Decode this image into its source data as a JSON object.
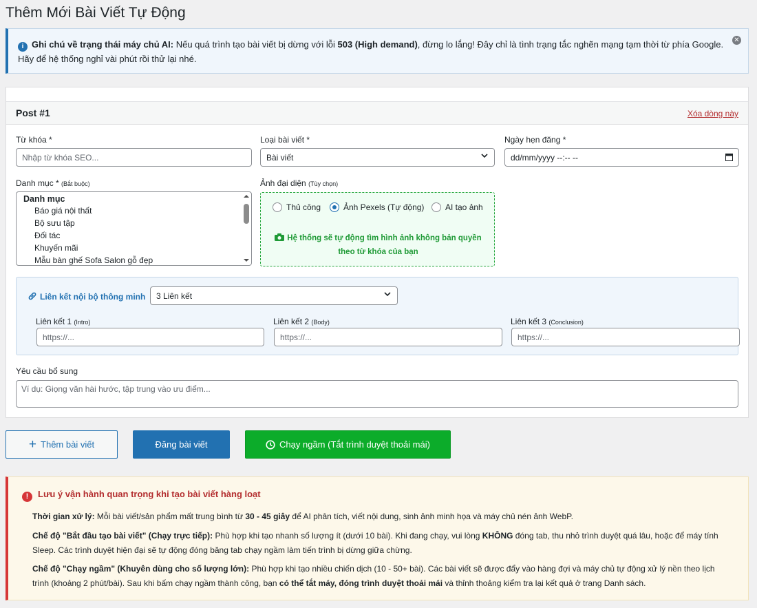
{
  "page": {
    "title": "Thêm Mới Bài Viết Tự Động"
  },
  "notice": {
    "label": "Ghi chú về trạng thái máy chủ AI:",
    "text_a": " Nếu quá trình tạo bài viết bị dừng với lỗi ",
    "error": "503 (High demand)",
    "text_b": ", đừng lo lắng! Đây chỉ là tình trạng tắc nghẽn mạng tạm thời từ phía Google. Hãy để hệ thống nghỉ vài phút rồi thử lại nhé.",
    "info_icon": "i",
    "close_icon": "✕"
  },
  "post": {
    "title": "Post #1",
    "delete_label": "Xóa dòng này",
    "keyword": {
      "label": "Từ khóa *",
      "placeholder": "Nhập từ khóa SEO...",
      "value": ""
    },
    "post_type": {
      "label": "Loại bài viết *",
      "value": "Bài viết"
    },
    "schedule": {
      "label": "Ngày hẹn đăng *",
      "value": "dd/mm/yyyy --:-- --"
    },
    "category": {
      "label": "Danh mục *",
      "note": "(Bắt buộc)",
      "header": "Danh mục",
      "items": [
        "Báo giá nội thất",
        "Bộ sưu tập",
        "Đối tác",
        "Khuyến mãi",
        "Mẫu bàn ghế Sofa Salon gỗ đẹp"
      ]
    },
    "image": {
      "label": "Ảnh đại diện",
      "note": "(Tùy chọn)",
      "options": [
        {
          "label": "Thủ công",
          "selected": false
        },
        {
          "label": "Ảnh Pexels (Tự động)",
          "selected": true
        },
        {
          "label": "AI tạo ảnh",
          "selected": false
        }
      ],
      "message_line1": "Hệ thống sẽ tự động tìm hình ảnh không bản quyền",
      "message_line2": "theo từ khóa của bạn",
      "camera_icon": "camera-icon"
    },
    "internal_links": {
      "label": "Liên kết nội bộ thông minh",
      "count_value": "3 Liên kết",
      "link1": {
        "label": "Liên kết 1",
        "note": "(Intro)",
        "placeholder": "https://..."
      },
      "link2": {
        "label": "Liên kết 2",
        "note": "(Body)",
        "placeholder": "https://..."
      },
      "link3": {
        "label": "Liên kết 3",
        "note": "(Conclusion)",
        "placeholder": "https://..."
      }
    },
    "extra": {
      "label": "Yêu cầu bổ sung",
      "placeholder": "Ví dụ: Giọng văn hài hước, tập trung vào ưu điểm..."
    }
  },
  "actions": {
    "add_label": "Thêm bài viết",
    "post_label": "Đăng bài viết",
    "background_label": "Chạy ngầm (Tắt trình duyệt thoải mái)"
  },
  "warning": {
    "title": "Lưu ý vận hành quan trọng khi tạo bài viết hàng loạt",
    "p1_label": "Thời gian xử lý:",
    "p1_a": " Mỗi bài viết/sản phẩm mất trung bình từ ",
    "p1_b": "30 - 45 giây",
    "p1_c": " để AI phân tích, viết nội dung, sinh ảnh minh họa và máy chủ nén ảnh WebP.",
    "p2_label": "Chế độ \"Bắt đầu tạo bài viết\" (Chạy trực tiếp):",
    "p2_a": " Phù hợp khi tạo nhanh số lượng ít (dưới 10 bài). Khi đang chạy, vui lòng ",
    "p2_b": "KHÔNG",
    "p2_c": " đóng tab, thu nhỏ trình duyệt quá lâu, hoặc để máy tính Sleep. Các trình duyệt hiện đại sẽ tự động đóng băng tab chạy ngầm làm tiến trình bị dừng giữa chừng.",
    "p3_label": "Chế độ \"Chạy ngầm\" (Khuyên dùng cho số lượng lớn):",
    "p3_a": " Phù hợp khi tạo nhiều chiến dịch (10 - 50+ bài). Các bài viết sẽ được đẩy vào hàng đợi và máy chủ tự động xử lý nền theo lịch trình (khoảng 2 phút/bài). Sau khi bấm chạy ngầm thành công, bạn ",
    "p3_b": "có thể tắt máy, đóng trình duyệt thoải mái",
    "p3_c": " và thỉnh thoảng kiểm tra lại kết quả ở trang Danh sách."
  },
  "colors": {
    "primary": "#2271b1",
    "success": "#0cac2a",
    "danger": "#d63638",
    "warning_bg": "#fdf8ea"
  }
}
